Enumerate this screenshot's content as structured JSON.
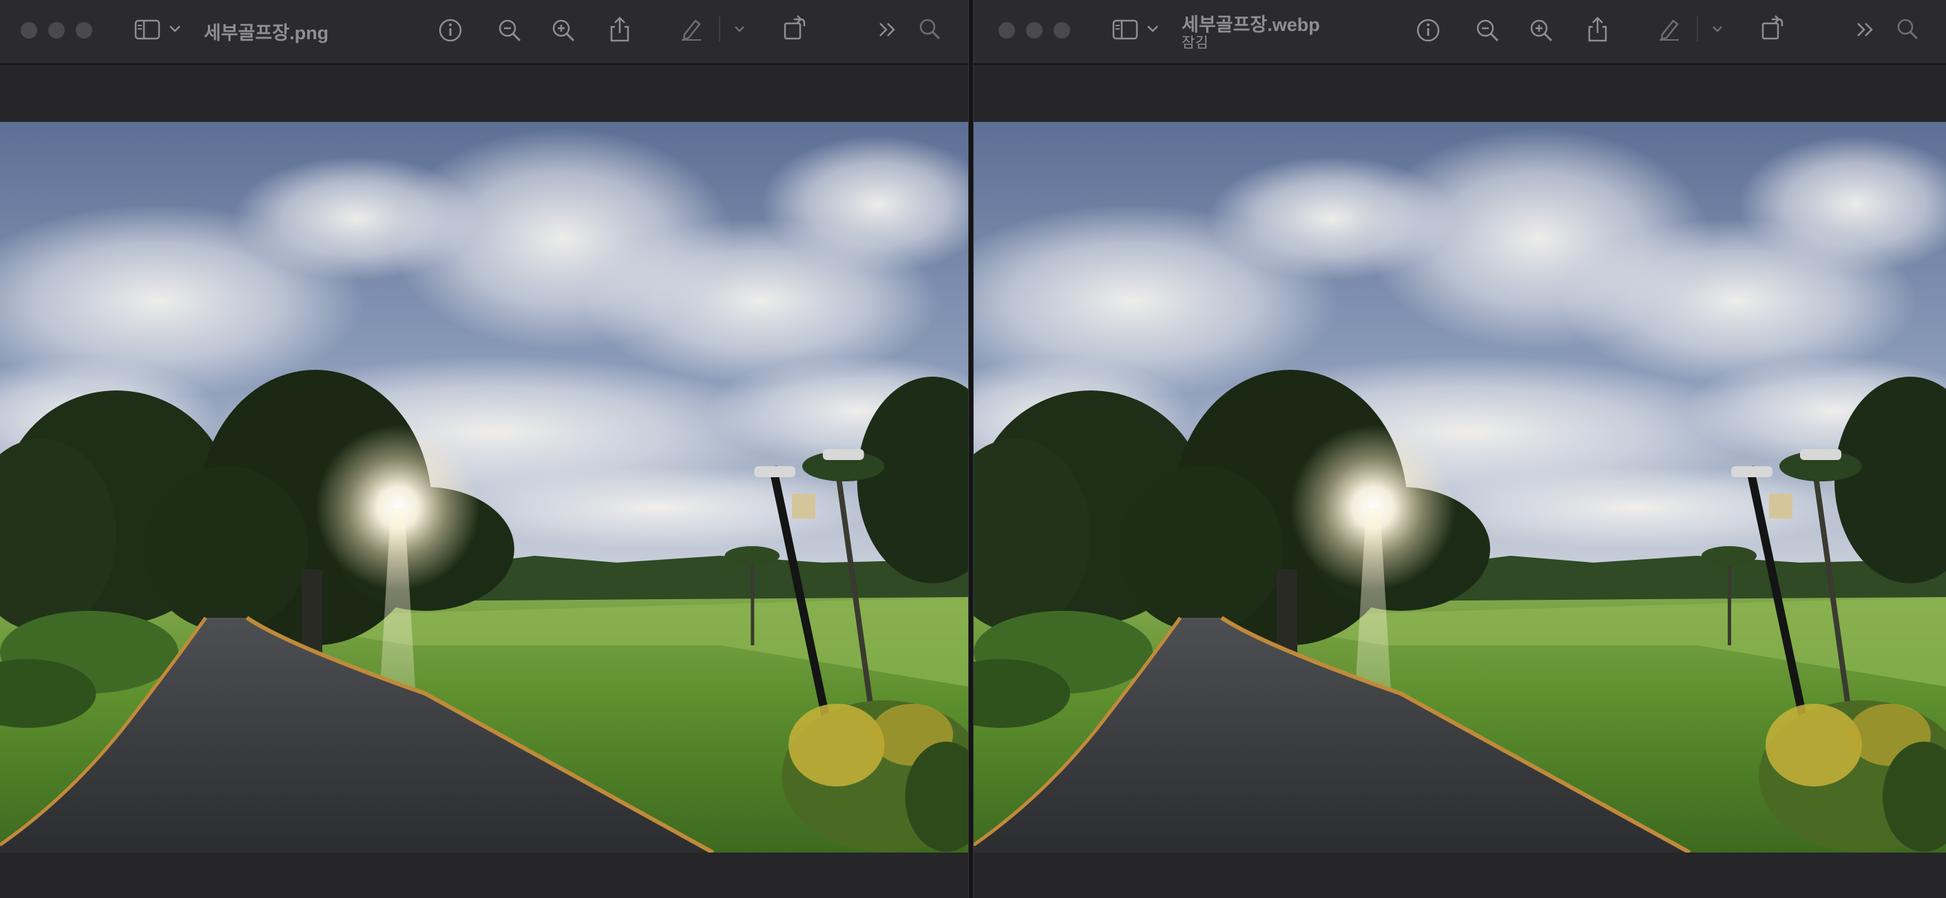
{
  "windows": [
    {
      "id": "left",
      "title": "세부골프장.png",
      "subtitle": "",
      "image_description_label": "golf course photo"
    },
    {
      "id": "right",
      "title": "세부골프장.webp",
      "subtitle": "잠김",
      "image_description_label": "golf course photo"
    }
  ],
  "toolbar": {
    "icons": [
      "sidebar-icon",
      "chevron-down-icon",
      "info-icon",
      "zoom-out-icon",
      "zoom-in-icon",
      "share-icon",
      "markup-pen-icon",
      "chevron-down-icon",
      "rotate-icon",
      "more-chevrons-icon",
      "search-icon"
    ]
  },
  "colors": {
    "titlebar": "#2b2b2d",
    "icon": "#8e8e93",
    "background": "#262628"
  }
}
